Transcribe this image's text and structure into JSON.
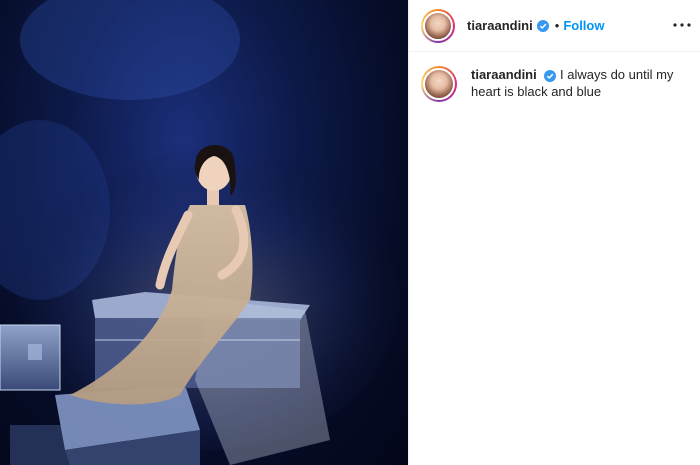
{
  "post": {
    "username": "tiaraandini",
    "follow_label": "Follow",
    "separator": "•",
    "caption": "I always do until my heart is black and blue"
  },
  "icons": {
    "verified": "verified-badge-icon",
    "more": "more-options-icon"
  },
  "colors": {
    "follow": "#0095f6",
    "verified": "#3897f0",
    "text": "#262626"
  }
}
